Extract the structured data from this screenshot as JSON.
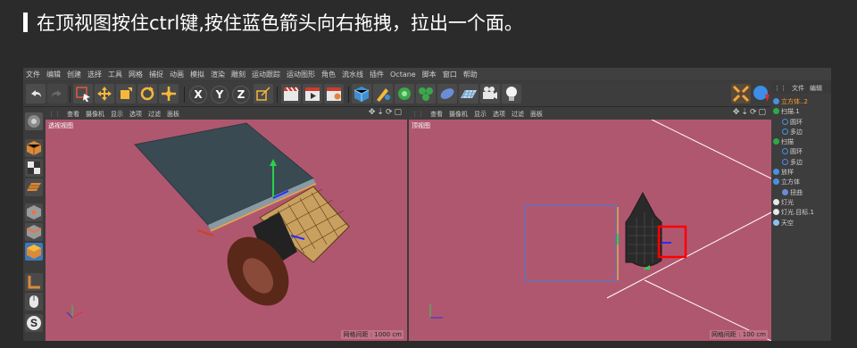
{
  "caption": "在顶视图按住ctrl键,按住蓝色箭头向右拖拽，拉出一个面。",
  "menu": [
    "文件",
    "编辑",
    "创建",
    "选择",
    "工具",
    "网格",
    "捕捉",
    "动画",
    "模拟",
    "渲染",
    "雕刻",
    "运动跟踪",
    "运动图形",
    "角色",
    "流水线",
    "插件",
    "Octane",
    "脚本",
    "窗口",
    "帮助"
  ],
  "toolbar": {
    "x_label": "X",
    "y_label": "Y",
    "z_label": "Z"
  },
  "viewport_menu": [
    "查看",
    "摄像机",
    "显示",
    "选项",
    "过滤",
    "面板"
  ],
  "viewport_left": {
    "title": "透视视图",
    "status": "网格间距 : 1000 cm"
  },
  "viewport_right": {
    "title": "顶视图",
    "status": "网格间距 : 100 cm"
  },
  "object_manager": {
    "tabs": [
      "文件",
      "编辑"
    ],
    "items": [
      {
        "label": "立方体..2",
        "color": "#ff9c2a"
      },
      {
        "label": "扫描.1",
        "color": "#cfcfcf"
      },
      {
        "label": "圆环",
        "color": "#cfcfcf"
      },
      {
        "label": "多边",
        "color": "#cfcfcf"
      },
      {
        "label": "扫描",
        "color": "#cfcfcf"
      },
      {
        "label": "圆环",
        "color": "#cfcfcf"
      },
      {
        "label": "多边",
        "color": "#cfcfcf"
      },
      {
        "label": "放样",
        "color": "#cfcfcf"
      },
      {
        "label": "立方体",
        "color": "#cfcfcf"
      },
      {
        "label": "扭曲",
        "color": "#cfcfcf"
      },
      {
        "label": "灯光",
        "color": "#cfcfcf"
      },
      {
        "label": "灯光.目标.1",
        "color": "#cfcfcf"
      },
      {
        "label": "天空",
        "color": "#cfcfcf"
      }
    ]
  },
  "colors": {
    "viewport_bg": "#b05770",
    "highlight_box": "#ff0000",
    "selected_item": "#ff9c2a"
  }
}
